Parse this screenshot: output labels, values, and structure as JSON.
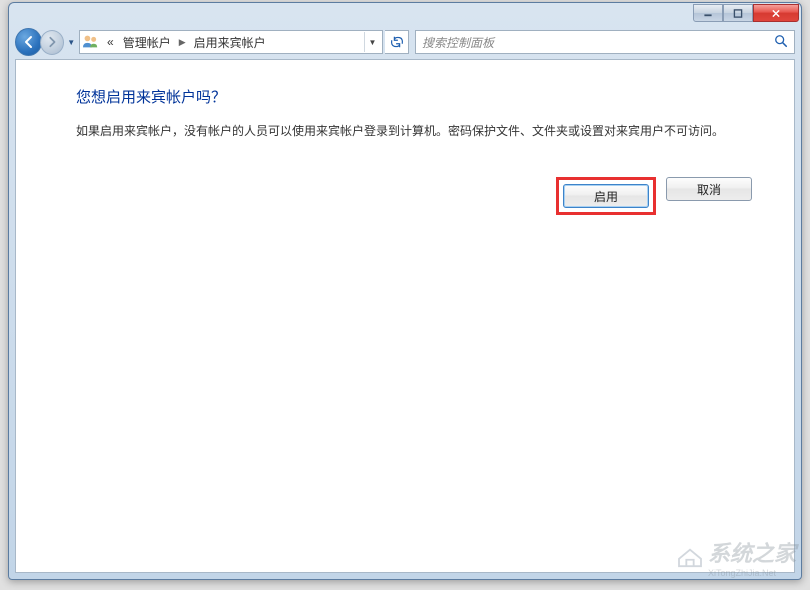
{
  "breadcrumb": {
    "prefix": "«",
    "item1": "管理帐户",
    "item2": "启用来宾帐户"
  },
  "search": {
    "placeholder": "搜索控制面板"
  },
  "content": {
    "heading": "您想启用来宾帐户吗？",
    "description": "如果启用来宾帐户，没有帐户的人员可以使用来宾帐户登录到计算机。密码保护文件、文件夹或设置对来宾用户不可访问。"
  },
  "buttons": {
    "enable": "启用",
    "cancel": "取消"
  },
  "watermark": {
    "text": "系统之家",
    "url": "XiTongZhiJia.Net"
  }
}
